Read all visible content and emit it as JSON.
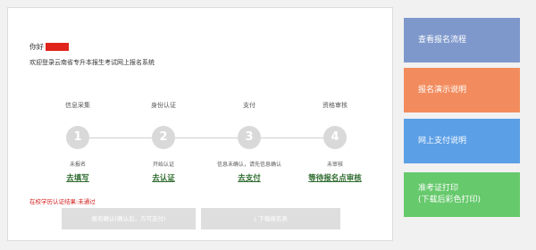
{
  "greeting": "你好",
  "welcome": "欢迎登录云南省专升本报生考试网上报名系统",
  "steps": [
    {
      "num": "1",
      "title": "信息采集",
      "state": "未报名",
      "action": "去填写"
    },
    {
      "num": "2",
      "title": "身份认证",
      "state": "开始认证",
      "action": "去认证"
    },
    {
      "num": "3",
      "title": "支付",
      "state": "信息未确认，请先信息确认",
      "action": "去支付"
    },
    {
      "num": "4",
      "title": "资格审核",
      "state": "未审核",
      "action": "等待报名点审核"
    }
  ],
  "result_text": "在校学历认证结果:未通过",
  "buttons": {
    "confirm": "报名确认(确认后，方可支付)",
    "download": "下载报名表"
  },
  "sidebar": [
    {
      "label_lines": [
        "查看报名流程"
      ],
      "color": "#7e98cc"
    },
    {
      "label_lines": [
        "报名演示说明"
      ],
      "color": "#f28c5e"
    },
    {
      "label_lines": [
        "网上支付说明"
      ],
      "color": "#5b9fe6"
    },
    {
      "label_lines": [
        "准考证打印",
        "(下载后彩色打印)"
      ],
      "color": "#66c96c"
    }
  ],
  "colors": {
    "link": "#2e6b2e",
    "error": "#d31c1c",
    "step_circle": "#d9d9d9"
  }
}
